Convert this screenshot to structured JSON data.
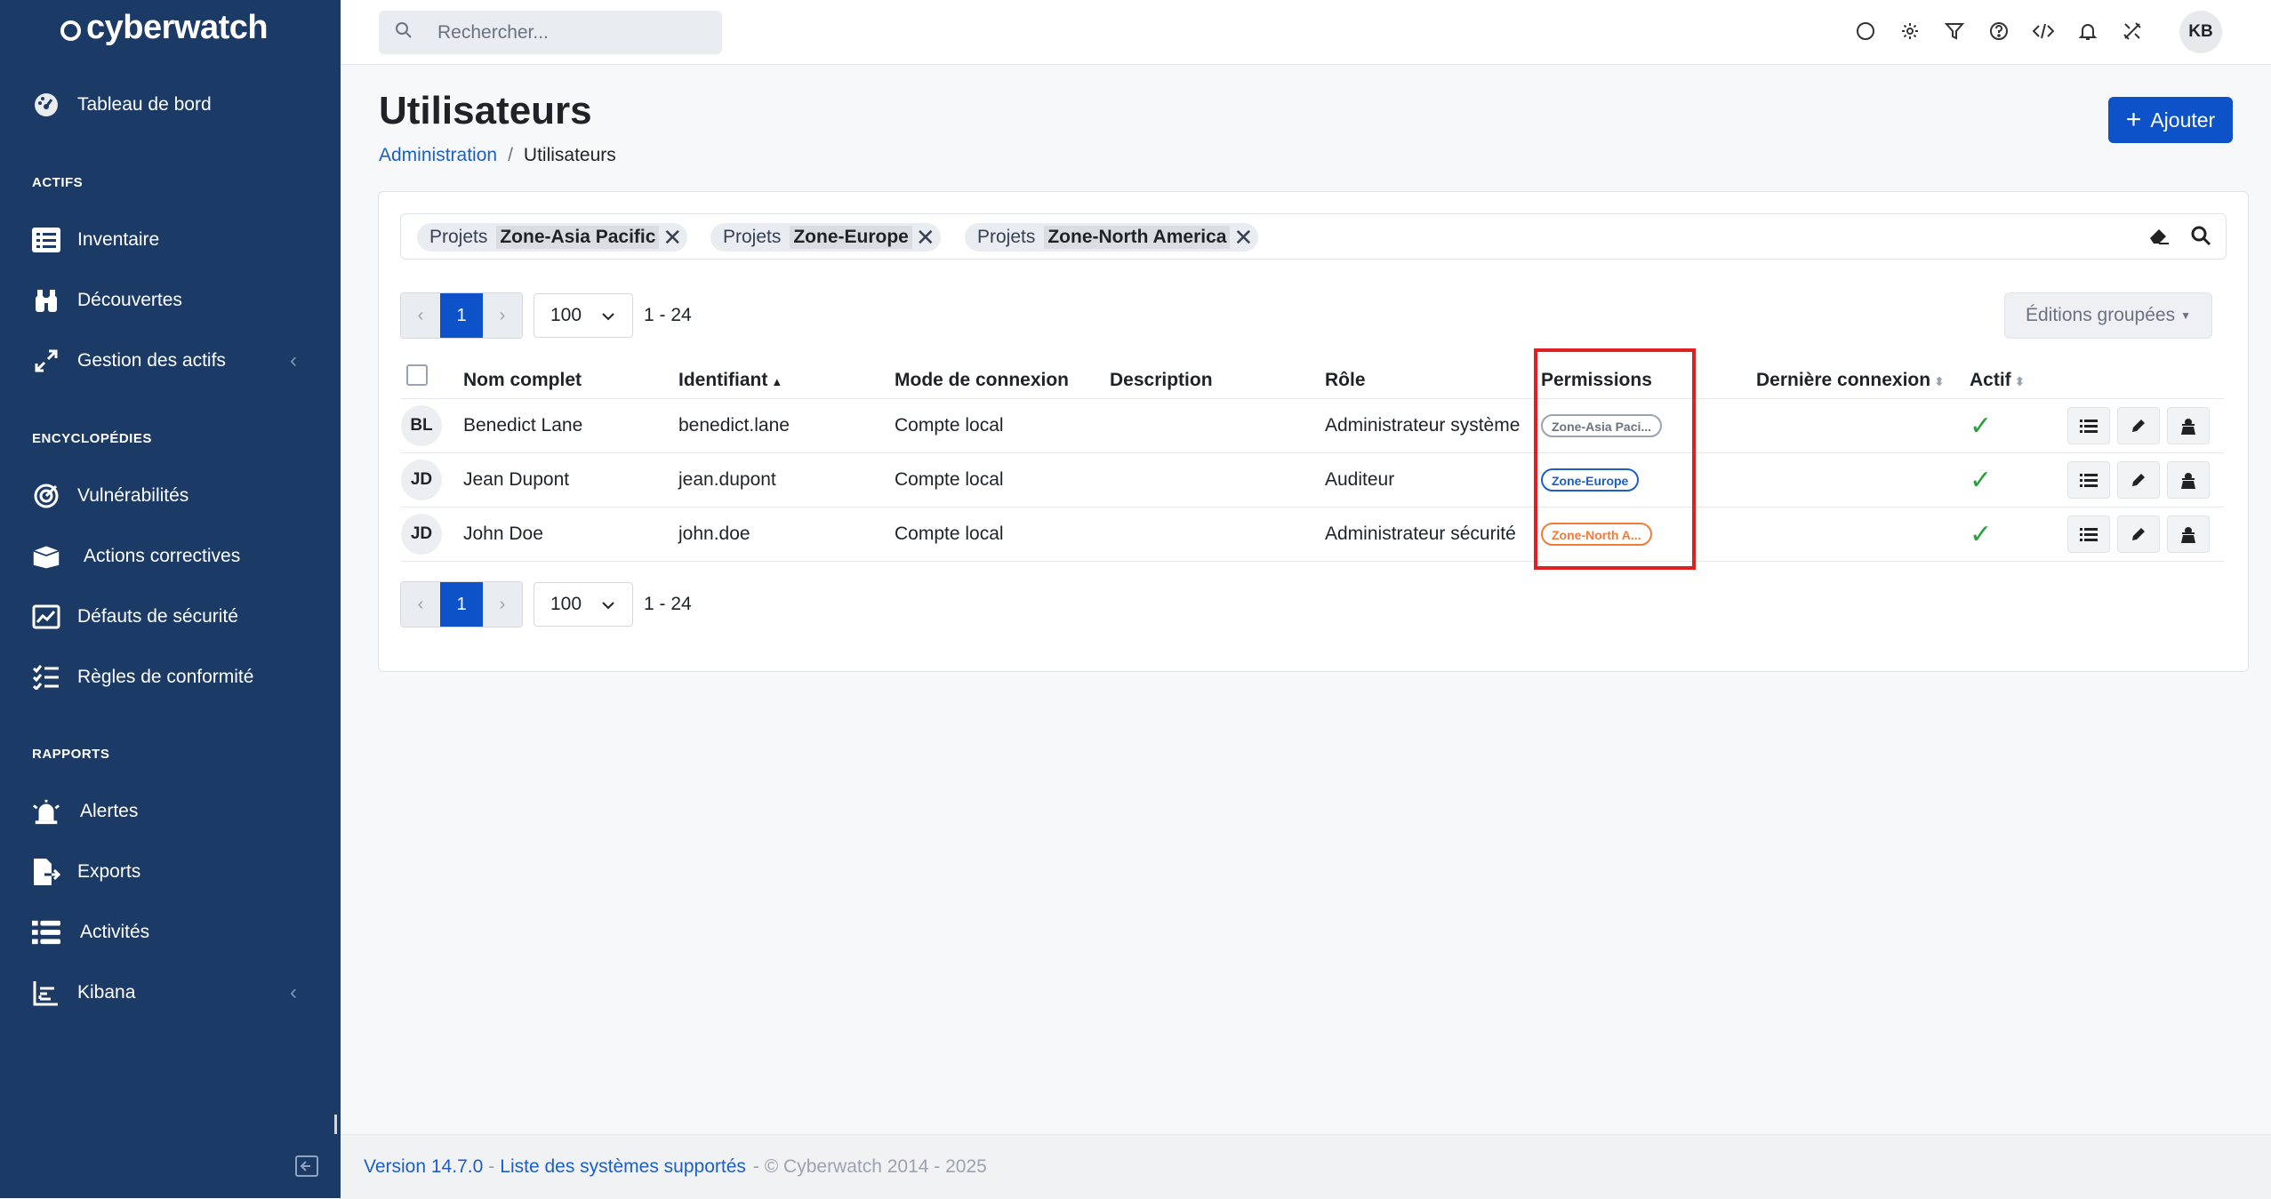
{
  "sidebar": {
    "brand": "cyberwatch",
    "dashboard": "Tableau de bord",
    "sections": {
      "assets": "ACTIFS",
      "encyclopedias": "ENCYCLOPÉDIES",
      "reports": "RAPPORTS"
    },
    "items": {
      "inventory": "Inventaire",
      "discoveries": "Découvertes",
      "asset_management": "Gestion des actifs",
      "vulnerabilities": "Vulnérabilités",
      "remediations": "Actions correctives",
      "security_defaults": "Défauts de sécurité",
      "compliance_rules": "Règles de conformité",
      "alerts": "Alertes",
      "exports": "Exports",
      "activities": "Activités",
      "kibana": "Kibana"
    }
  },
  "topbar": {
    "search_placeholder": "Rechercher...",
    "user_initials": "KB",
    "icons": [
      "circle-icon",
      "gear-icon",
      "filter-icon",
      "help-icon",
      "code-icon",
      "bell-icon",
      "tools-icon"
    ]
  },
  "page": {
    "title": "Utilisateurs",
    "breadcrumb_parent": "Administration",
    "breadcrumb_sep": "/",
    "breadcrumb_current": "Utilisateurs",
    "add_label": "Ajouter"
  },
  "filters": [
    {
      "key": "Projets",
      "value": "Zone-Asia Pacific"
    },
    {
      "key": "Projets",
      "value": "Zone-Europe"
    },
    {
      "key": "Projets",
      "value": "Zone-North America"
    }
  ],
  "pagination": {
    "prev": "‹",
    "current": "1",
    "next": "›",
    "page_size": "100",
    "range": "1 - 24"
  },
  "bulk_edit_label": "Éditions groupées",
  "table": {
    "columns": {
      "full_name": "Nom complet",
      "identifier": "Identifiant",
      "login_mode": "Mode de connexion",
      "description": "Description",
      "role": "Rôle",
      "permissions": "Permissions",
      "last_login": "Dernière connexion",
      "active": "Actif"
    },
    "rows": [
      {
        "initials": "BL",
        "name": "Benedict Lane",
        "identifier": "benedict.lane",
        "login_mode": "Compte local",
        "description": "",
        "role": "Administrateur système",
        "permission": "Zone-Asia Paci...",
        "last_login": "",
        "active": "✓"
      },
      {
        "initials": "JD",
        "name": "Jean Dupont",
        "identifier": "jean.dupont",
        "login_mode": "Compte local",
        "description": "",
        "role": "Auditeur",
        "permission": "Zone-Europe",
        "last_login": "",
        "active": "✓"
      },
      {
        "initials": "JD",
        "name": "John Doe",
        "identifier": "john.doe",
        "login_mode": "Compte local",
        "description": "",
        "role": "Administrateur sécurité",
        "permission": "Zone-North A...",
        "last_login": "",
        "active": "✓"
      }
    ]
  },
  "footer": {
    "version": "Version  14.7.0",
    "dash1": "-",
    "supported": "Liste des systèmes supportés",
    "copyright": "- © Cyberwatch 2014 - 2025"
  },
  "colors": {
    "sidebar_bg": "#1c3a66",
    "primary": "#0d52c9",
    "highlight_box": "#e02020",
    "check": "#2e9e3e"
  }
}
